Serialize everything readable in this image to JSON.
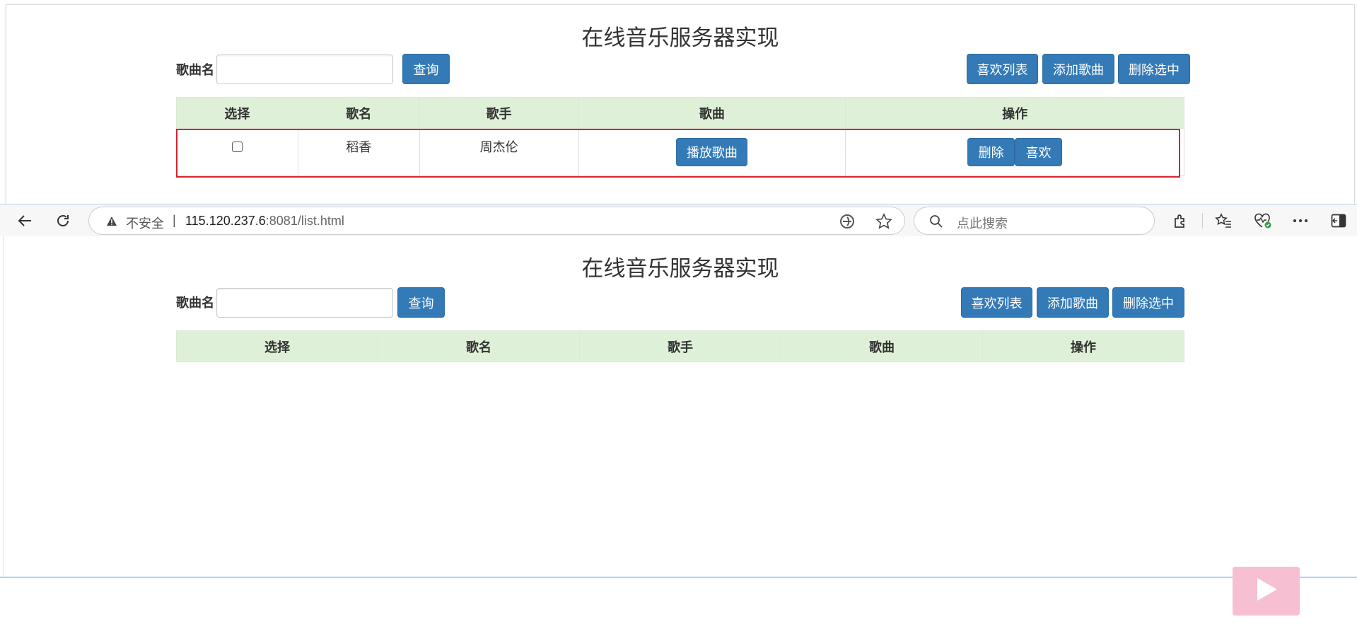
{
  "app": {
    "title": "在线音乐服务器实现",
    "search_label": "歌曲名",
    "search_value": "",
    "query_button": "查询",
    "favorites_button": "喜欢列表",
    "add_song_button": "添加歌曲",
    "delete_selected_button": "删除选中"
  },
  "table": {
    "headers": [
      "选择",
      "歌名",
      "歌手",
      "歌曲",
      "操作"
    ],
    "rows": [
      {
        "checked": false,
        "song": "稻香",
        "singer": "周杰伦",
        "play_label": "播放歌曲",
        "delete_label": "删除",
        "like_label": "喜欢"
      }
    ]
  },
  "browser": {
    "not_secure": "不安全",
    "url_host": "115.120.237.6",
    "url_rest": ":8081/list.html",
    "search_placeholder": "点此搜索"
  },
  "colors": {
    "primary": "#337ab7",
    "header_bg": "#dff0d8",
    "highlight": "#d9232e",
    "player_bg": "#f7bfd2"
  }
}
